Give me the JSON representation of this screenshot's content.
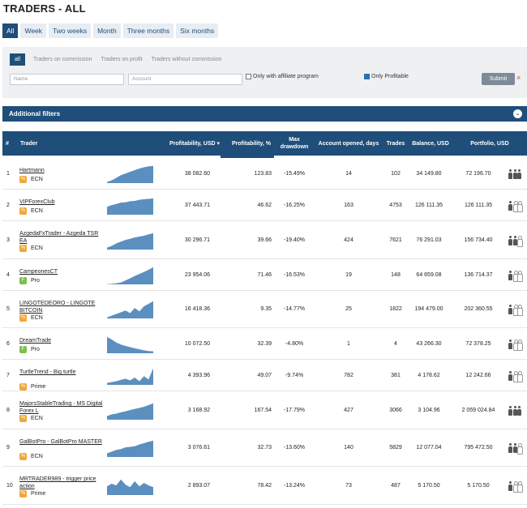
{
  "page_title": "TRADERS - ALL",
  "periods": [
    "All",
    "Week",
    "Two weeks",
    "Month",
    "Three months",
    "Six months"
  ],
  "subtabs": [
    "all",
    "Traders on commission",
    "Traders on profit",
    "Traders without commission"
  ],
  "filters": {
    "name_placeholder": "Name",
    "account_placeholder": "Account",
    "affiliate_label": "Only with affiliate program",
    "profitable_label": "Only Profitable",
    "submit_label": "Submit",
    "clear_glyph": "×"
  },
  "additional_filters": "Additional filters",
  "columns": {
    "num": "#",
    "trader": "Trader",
    "prof_usd": "Profitability, USD ▾",
    "prof_pct": "Profitability, %",
    "drawdown": "Max drawdown",
    "opened": "Account opened, days",
    "trades": "Trades",
    "balance": "Balance, USD",
    "portfolio": "Portfolio, USD"
  },
  "rows": [
    {
      "num": "1",
      "name": "Hartmann",
      "tag": "ECN",
      "prof_usd": "38 082.60",
      "prof_pct": "123.83",
      "drawdown": "-15.49%",
      "opened": "14",
      "trades": "102",
      "balance": "34 149.80",
      "portfolio": "72 196.70",
      "men": 3
    },
    {
      "num": "2",
      "name": "VIPForexClub",
      "tag": "ECN",
      "prof_usd": "37 443.71",
      "prof_pct": "46.62",
      "drawdown": "-16.25%",
      "opened": "163",
      "trades": "4753",
      "balance": "126 111.35",
      "portfolio": "126 111.35",
      "men": 1
    },
    {
      "num": "3",
      "name": "AzgedaFxTrader - Azgeda TSR EA",
      "tag": "ECN",
      "prof_usd": "30 296.71",
      "prof_pct": "39.66",
      "drawdown": "-19.40%",
      "opened": "424",
      "trades": "7621",
      "balance": "76 291.03",
      "portfolio": "156 734.40",
      "men": 2
    },
    {
      "num": "4",
      "name": "CampeonesCT",
      "tag": "Pro",
      "prof_usd": "23 954.06",
      "prof_pct": "71.46",
      "drawdown": "-16.53%",
      "opened": "19",
      "trades": "148",
      "balance": "64 659.08",
      "portfolio": "136 714.37",
      "men": 1
    },
    {
      "num": "5",
      "name": "LINGOTEDEORO - LINGOTE BITCOIN",
      "tag": "ECN",
      "prof_usd": "16 418.36",
      "prof_pct": "9.35",
      "drawdown": "-14.77%",
      "opened": "25",
      "trades": "1822",
      "balance": "194 479.00",
      "portfolio": "202 360.55",
      "men": 1
    },
    {
      "num": "6",
      "name": "DreamTrade",
      "tag": "Pro",
      "prof_usd": "10 072.50",
      "prof_pct": "32.39",
      "drawdown": "-4.80%",
      "opened": "1",
      "trades": "4",
      "balance": "43 266.30",
      "portfolio": "72 378.25",
      "men": 1
    },
    {
      "num": "7",
      "name": "TurtleTrend - Big turtle",
      "tag": "Prime",
      "prof_usd": "4 393.96",
      "prof_pct": "49.07",
      "drawdown": "-9.74%",
      "opened": "782",
      "trades": "381",
      "balance": "4 178.62",
      "portfolio": "12 242.66",
      "men": 1
    },
    {
      "num": "8",
      "name": "MajorsStableTrading - MS Digital Forex L",
      "tag": "ECN",
      "prof_usd": "3 168.92",
      "prof_pct": "167.54",
      "drawdown": "-17.79%",
      "opened": "427",
      "trades": "3066",
      "balance": "3 104.96",
      "portfolio": "2 059 024.84",
      "men": 3
    },
    {
      "num": "9",
      "name": "GalBotPro - GalBotPro MASTER",
      "tag": "ECN",
      "prof_usd": "3 076.61",
      "prof_pct": "32.73",
      "drawdown": "-13.60%",
      "opened": "140",
      "trades": "5829",
      "balance": "12 077.04",
      "portfolio": "795 472.50",
      "men": 2
    },
    {
      "num": "10",
      "name": "MRTRADER989 - trigger price action",
      "tag": "Prime",
      "prof_usd": "2 893.07",
      "prof_pct": "78.42",
      "drawdown": "-13.24%",
      "opened": "73",
      "trades": "487",
      "balance": "5 170.50",
      "portfolio": "5 170.50",
      "men": 1
    }
  ],
  "sparklines": [
    [
      0.05,
      0.15,
      0.3,
      0.45,
      0.55,
      0.65,
      0.75,
      0.85,
      0.92,
      0.97,
      1.0
    ],
    [
      0.45,
      0.55,
      0.62,
      0.7,
      0.72,
      0.78,
      0.8,
      0.86,
      0.9,
      0.92,
      0.95
    ],
    [
      0.1,
      0.2,
      0.35,
      0.45,
      0.55,
      0.62,
      0.7,
      0.75,
      0.8,
      0.88,
      0.95
    ],
    [
      0.0,
      0.02,
      0.05,
      0.1,
      0.22,
      0.35,
      0.48,
      0.6,
      0.72,
      0.85,
      1.0
    ],
    [
      0.05,
      0.15,
      0.25,
      0.35,
      0.45,
      0.3,
      0.6,
      0.4,
      0.7,
      0.85,
      1.0
    ],
    [
      0.95,
      0.8,
      0.62,
      0.5,
      0.42,
      0.35,
      0.28,
      0.22,
      0.16,
      0.12,
      0.1
    ],
    [
      0.1,
      0.15,
      0.2,
      0.28,
      0.35,
      0.25,
      0.42,
      0.2,
      0.5,
      0.3,
      0.95
    ],
    [
      0.2,
      0.3,
      0.35,
      0.42,
      0.48,
      0.55,
      0.62,
      0.68,
      0.75,
      0.85,
      0.95
    ],
    [
      0.2,
      0.3,
      0.4,
      0.45,
      0.55,
      0.58,
      0.62,
      0.72,
      0.8,
      0.88,
      0.95
    ],
    [
      0.5,
      0.65,
      0.55,
      0.9,
      0.6,
      0.45,
      0.8,
      0.5,
      0.7,
      0.55,
      0.45
    ]
  ],
  "colors": {
    "accent": "#1f4e7a",
    "sparkline": "#5b8fbf",
    "tag_orange": "#f0a73a",
    "tag_green": "#7cbf4a"
  }
}
